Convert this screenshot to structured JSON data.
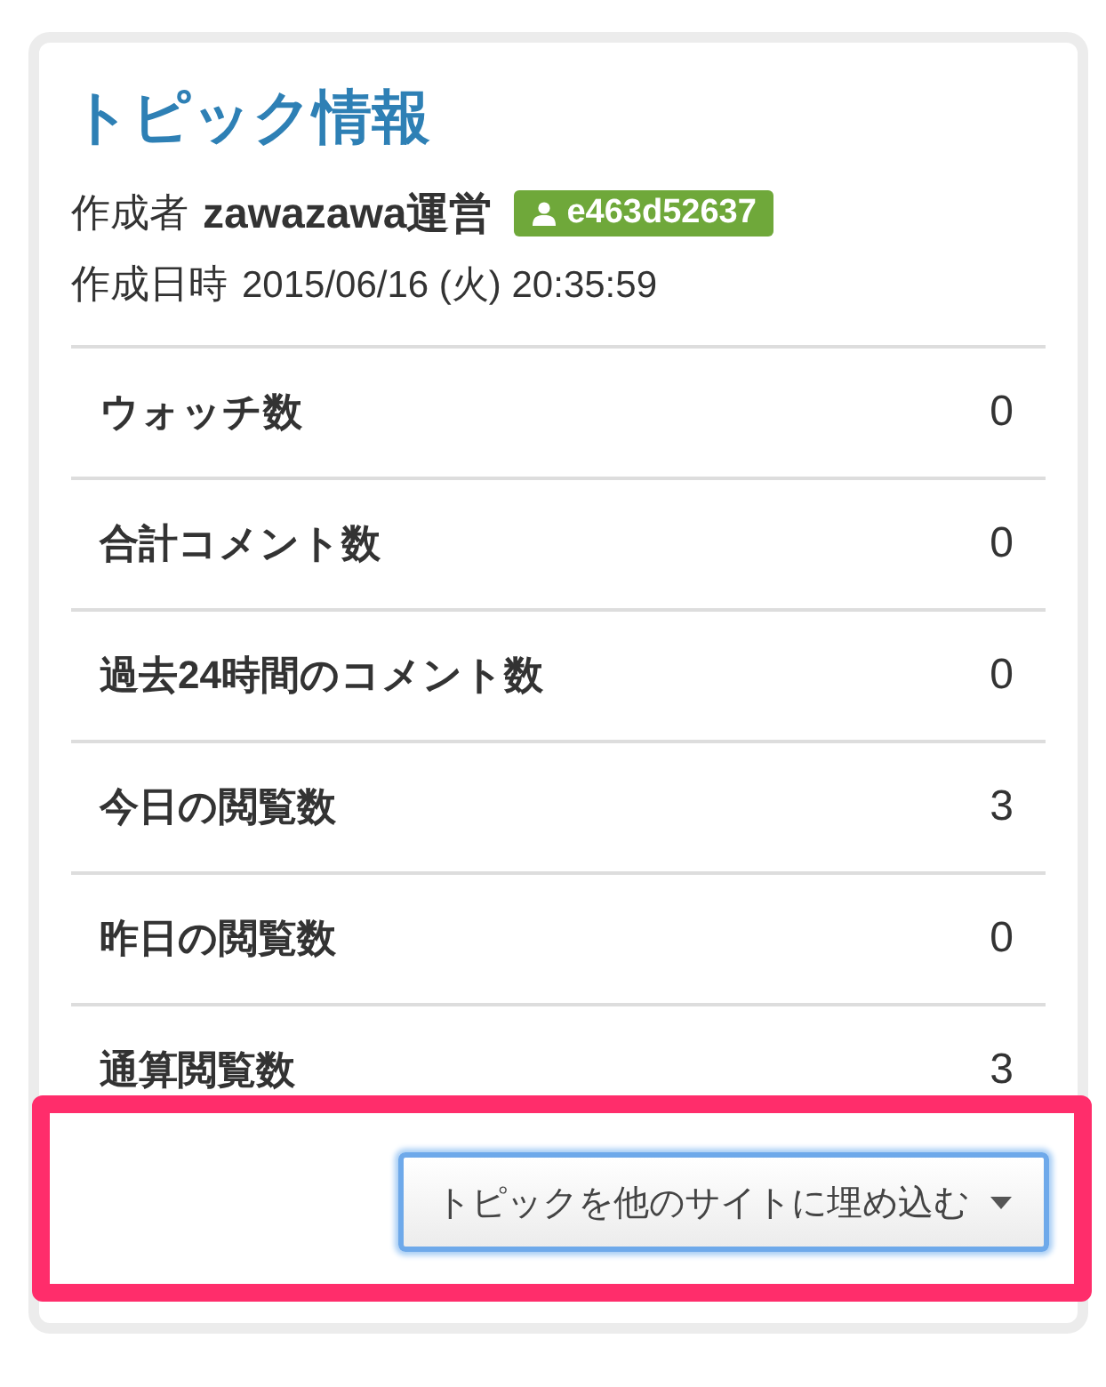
{
  "title": "トピック情報",
  "author": {
    "label": "作成者",
    "name": "zawazawa運営",
    "badge": "e463d52637"
  },
  "created": {
    "label": "作成日時",
    "value": "2015/06/16 (火) 20:35:59"
  },
  "stats": [
    {
      "label": "ウォッチ数",
      "value": "0"
    },
    {
      "label": "合計コメント数",
      "value": "0"
    },
    {
      "label": "過去24時間のコメント数",
      "value": "0"
    },
    {
      "label": "今日の閲覧数",
      "value": "3"
    },
    {
      "label": "昨日の閲覧数",
      "value": "0"
    },
    {
      "label": "通算閲覧数",
      "value": "3"
    }
  ],
  "embed_button": {
    "label": "トピックを他のサイトに埋め込む",
    "focused": true,
    "highlighted": true
  }
}
